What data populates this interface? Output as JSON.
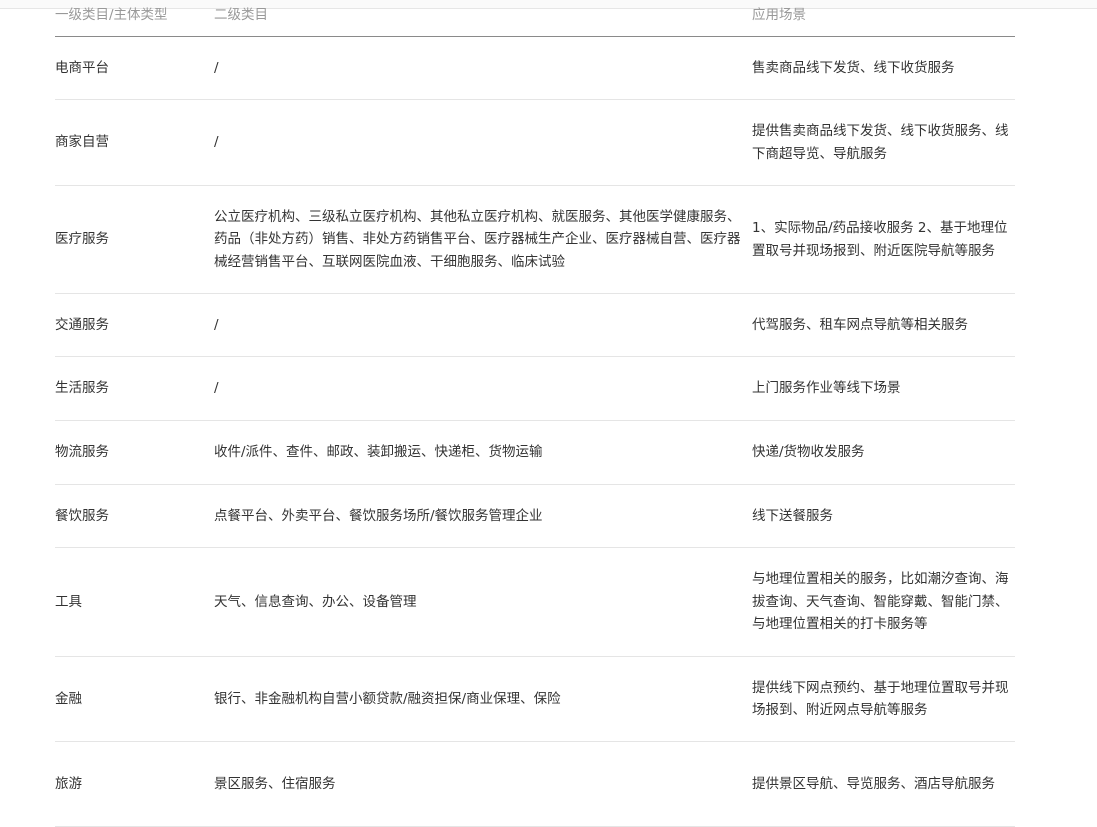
{
  "headers": [
    "一级类目/主体类型",
    "二级类目",
    "应用场景"
  ],
  "rows": [
    {
      "c1": "电商平台",
      "c2": "/",
      "c3": "售卖商品线下发货、线下收货服务"
    },
    {
      "c1": "商家自营",
      "c2": "/",
      "c3": "提供售卖商品线下发货、线下收货服务、线下商超导览、导航服务"
    },
    {
      "c1": "医疗服务",
      "c2": "公立医疗机构、三级私立医疗机构、其他私立医疗机构、就医服务、其他医学健康服务、药品（非处方药）销售、非处方药销售平台、医疗器械生产企业、医疗器械自营、医疗器械经营销售平台、互联网医院血液、干细胞服务、临床试验",
      "c3": "1、实际物品/药品接收服务 2、基于地理位置取号并现场报到、附近医院导航等服务"
    },
    {
      "c1": "交通服务",
      "c2": "/",
      "c3": "代驾服务、租车网点导航等相关服务"
    },
    {
      "c1": "生活服务",
      "c2": "/",
      "c3": "上门服务作业等线下场景"
    },
    {
      "c1": "物流服务",
      "c2": "收件/派件、查件、邮政、装卸搬运、快递柜、货物运输",
      "c3": "快递/货物收发服务"
    },
    {
      "c1": "餐饮服务",
      "c2": "点餐平台、外卖平台、餐饮服务场所/餐饮服务管理企业",
      "c3": "线下送餐服务"
    },
    {
      "c1": "工具",
      "c2": "天气、信息查询、办公、设备管理",
      "c3": "与地理位置相关的服务，比如潮汐查询、海拔查询、天气查询、智能穿戴、智能门禁、与地理位置相关的打卡服务等"
    },
    {
      "c1": "金融",
      "c2": "银行、非金融机构自营小额贷款/融资担保/商业保理、保险",
      "c3": "提供线下网点预约、基于地理位置取号并现场报到、附近网点导航等服务"
    },
    {
      "c1": "旅游",
      "c2": "景区服务、住宿服务",
      "c3": "提供景区导航、导览服务、酒店导航服务"
    }
  ]
}
